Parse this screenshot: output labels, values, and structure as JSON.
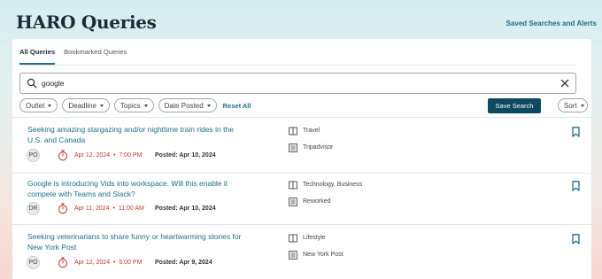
{
  "header": {
    "title": "HARO Queries",
    "saved_link": "Saved Searches and Alerts"
  },
  "tabs": [
    {
      "label": "All Queries",
      "active": true
    },
    {
      "label": "Bookmarked Queries",
      "active": false
    }
  ],
  "search": {
    "value": "google",
    "placeholder": ""
  },
  "filters": {
    "items": [
      {
        "label": "Outlet"
      },
      {
        "label": "Deadline"
      },
      {
        "label": "Topics"
      },
      {
        "label": "Date Posted"
      }
    ],
    "reset_label": "Reset All",
    "save_label": "Save Search",
    "sort_label": "Sort"
  },
  "queries": [
    {
      "title": "Seeking amazing stargazing and/or nighttime train rides in the U.S. and Canada",
      "initials": "PO",
      "deadline_date": "Apr 12, 2024",
      "deadline_time": "7:00 PM",
      "posted": "Posted: Apr 10, 2024",
      "topics": "Travel",
      "outlet": "Tripadvisor"
    },
    {
      "title": "Google is introducing Vids into workspace. Will this enable it compete with Teams and Slack?",
      "initials": "DR",
      "deadline_date": "Apr 11, 2024",
      "deadline_time": "11:00 AM",
      "posted": "Posted: Apr 10, 2024",
      "topics": "Technology, Business",
      "outlet": "Reworked"
    },
    {
      "title": "Seeking veterinarians to share funny or heartwarming stories for New York Post",
      "initials": "PO",
      "deadline_date": "Apr 12, 2024",
      "deadline_time": "6:00 PM",
      "posted": "Posted: Apr 9, 2024",
      "topics": "Lifestyle",
      "outlet": "New York Post"
    }
  ],
  "colors": {
    "accent": "#1f6f8b",
    "primary_button": "#0d4a5e",
    "deadline": "#c0392b"
  },
  "icons": {
    "search": "search-icon",
    "clear": "close-icon",
    "deadline": "stopwatch-icon",
    "topics": "book-icon",
    "outlet": "newspaper-icon",
    "bookmark": "bookmark-icon"
  }
}
